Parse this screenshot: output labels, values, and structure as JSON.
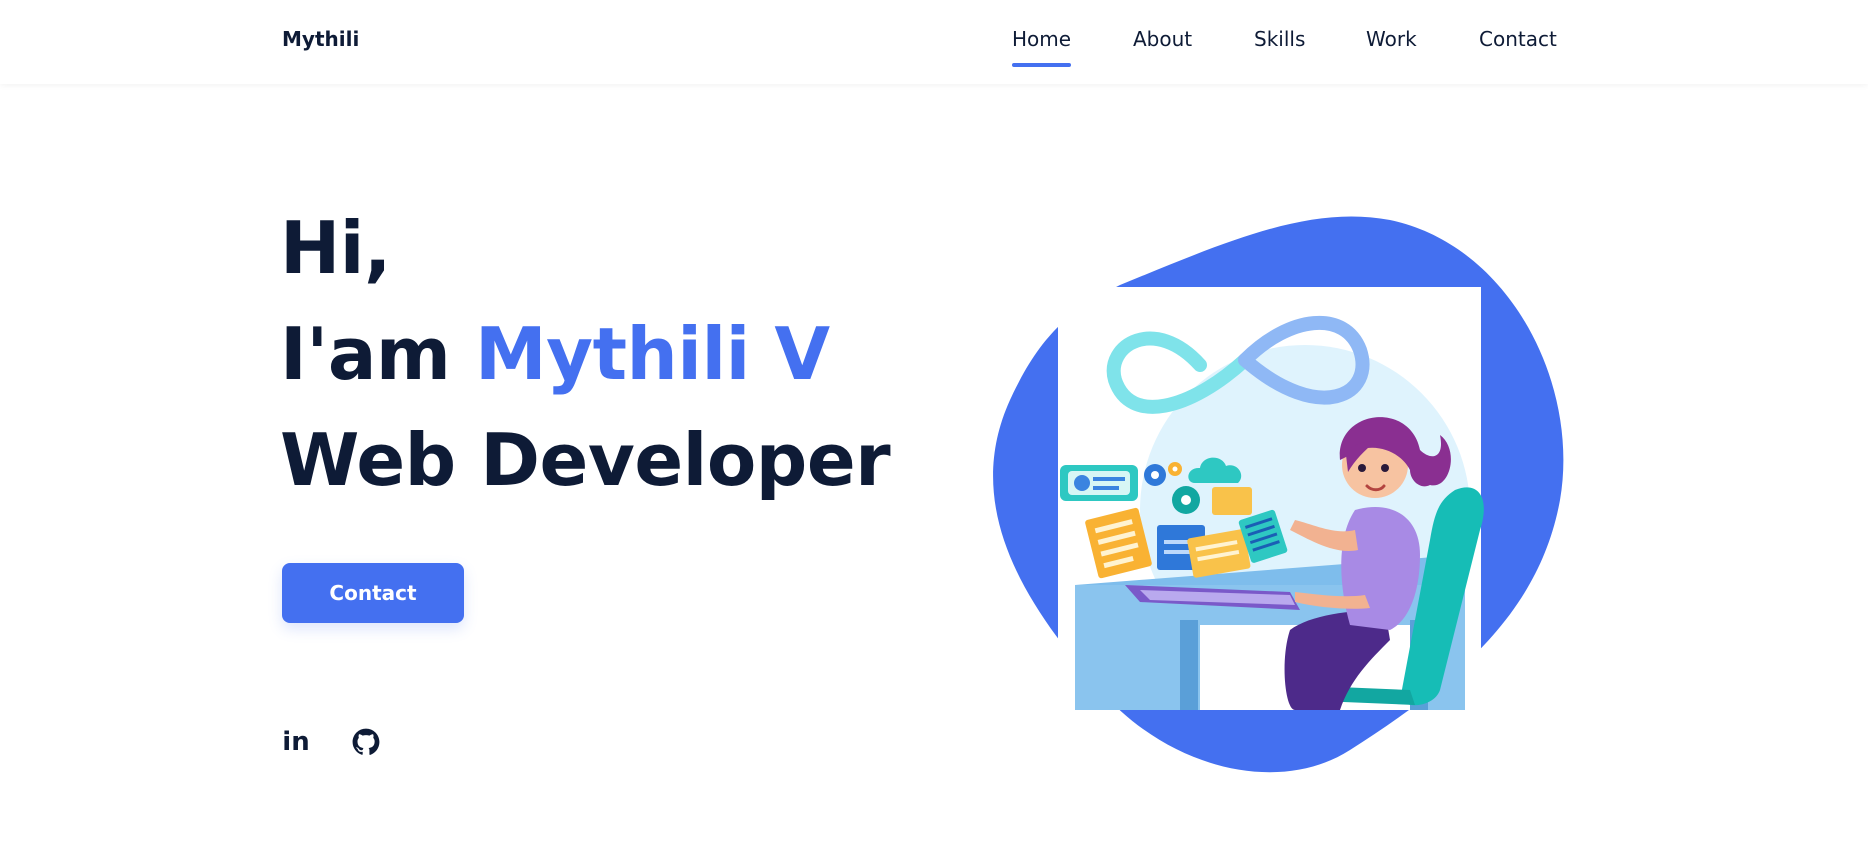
{
  "header": {
    "logo": "Mythili",
    "nav": [
      {
        "label": "Home",
        "active": true
      },
      {
        "label": "About",
        "active": false
      },
      {
        "label": "Skills",
        "active": false
      },
      {
        "label": "Work",
        "active": false
      },
      {
        "label": "Contact",
        "active": false
      }
    ]
  },
  "hero": {
    "line1": "Hi,",
    "line2_prefix": "I'am ",
    "line2_name": "Mythili V",
    "line3": "Web Developer",
    "button_label": "Contact"
  },
  "social": [
    {
      "icon": "linkedin-icon",
      "label": "in"
    },
    {
      "icon": "github-icon"
    }
  ],
  "colors": {
    "accent": "#4470f0",
    "text": "#0e1b36",
    "background": "#ffffff"
  },
  "illustration": {
    "icon": "developer-at-laptop-illustration"
  }
}
